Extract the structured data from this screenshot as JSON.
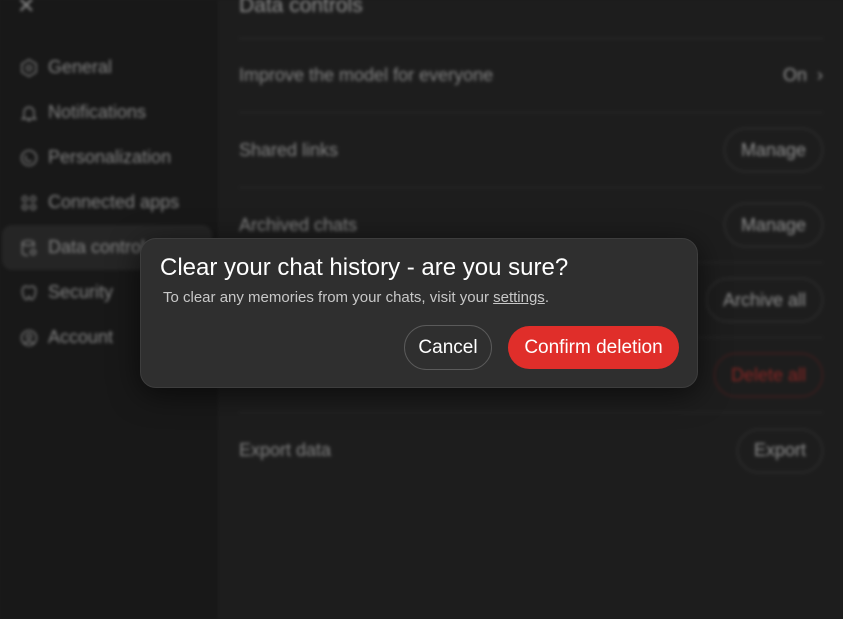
{
  "sidebar": {
    "close_icon": "close-icon",
    "items": [
      {
        "label": "General",
        "icon": "gear-icon"
      },
      {
        "label": "Notifications",
        "icon": "bell-icon"
      },
      {
        "label": "Personalization",
        "icon": "personalization-icon"
      },
      {
        "label": "Connected apps",
        "icon": "apps-icon"
      },
      {
        "label": "Data controls",
        "icon": "database-icon",
        "active": true
      },
      {
        "label": "Security",
        "icon": "security-icon"
      },
      {
        "label": "Account",
        "icon": "user-circle-icon"
      }
    ]
  },
  "content": {
    "title": "Data controls",
    "rows": {
      "improve": {
        "label": "Improve the model for everyone",
        "value": "On"
      },
      "shared": {
        "label": "Shared links",
        "action": "Manage"
      },
      "archived": {
        "label": "Archived chats",
        "action": "Manage"
      },
      "archive_all": {
        "action": "Archive all"
      },
      "delete_all": {
        "action": "Delete all"
      },
      "export": {
        "label": "Export data",
        "action": "Export"
      }
    }
  },
  "modal": {
    "title": "Clear your chat history - are you sure?",
    "text_before": "To clear any memories from your chats, visit your ",
    "link": "settings",
    "text_after": ".",
    "cancel_label": "Cancel",
    "confirm_label": "Confirm deletion",
    "confirm_color": "#e02e2a"
  }
}
